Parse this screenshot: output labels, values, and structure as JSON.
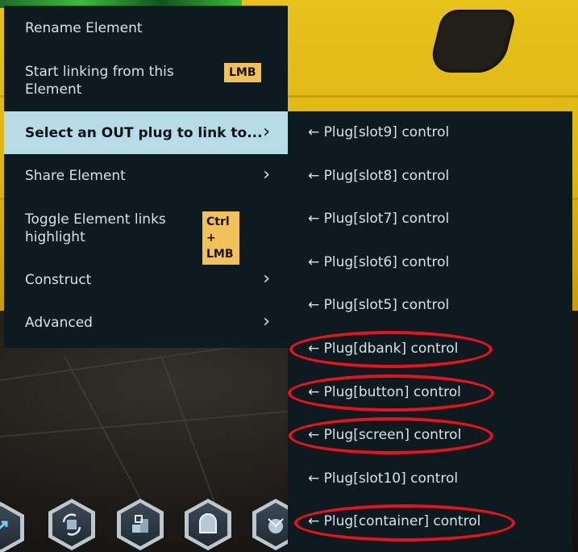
{
  "main_menu": {
    "items": [
      {
        "label": "Rename Element"
      },
      {
        "label": "Start linking from this Element",
        "shortcut": "LMB"
      },
      {
        "label": "Select an OUT plug to link to...",
        "submenu": true,
        "highlighted": true
      },
      {
        "label": "Share Element",
        "submenu": true
      },
      {
        "label": "Toggle Element links highlight",
        "shortcut": "Ctrl + LMB"
      },
      {
        "label": "Construct",
        "submenu": true
      },
      {
        "label": "Advanced",
        "submenu": true
      }
    ],
    "chevron_glyph": "›"
  },
  "sub_menu": {
    "items": [
      {
        "label": "← Plug[slot9] control",
        "circled": false
      },
      {
        "label": "← Plug[slot8] control",
        "circled": false
      },
      {
        "label": "← Plug[slot7] control",
        "circled": false
      },
      {
        "label": "← Plug[slot6] control",
        "circled": false
      },
      {
        "label": "← Plug[slot5] control",
        "circled": false
      },
      {
        "label": "← Plug[dbank] control",
        "circled": true
      },
      {
        "label": "← Plug[button] control",
        "circled": true
      },
      {
        "label": "← Plug[screen] control",
        "circled": true
      },
      {
        "label": "← Plug[slot10] control",
        "circled": false
      },
      {
        "label": "← Plug[container] control",
        "circled": true
      }
    ]
  },
  "toolbar_icons": [
    "link-tool-icon",
    "rotate-tool-icon",
    "cube-steps-icon",
    "curved-panel-icon",
    "radar-dish-icon"
  ],
  "colors": {
    "menu_bg": "#0d1a20",
    "highlight_bg": "#b8dbe8",
    "shortcut_bg": "#f2c25a",
    "annotation_ring": "#e8121c",
    "scene_yellow": "#e7c21a"
  }
}
